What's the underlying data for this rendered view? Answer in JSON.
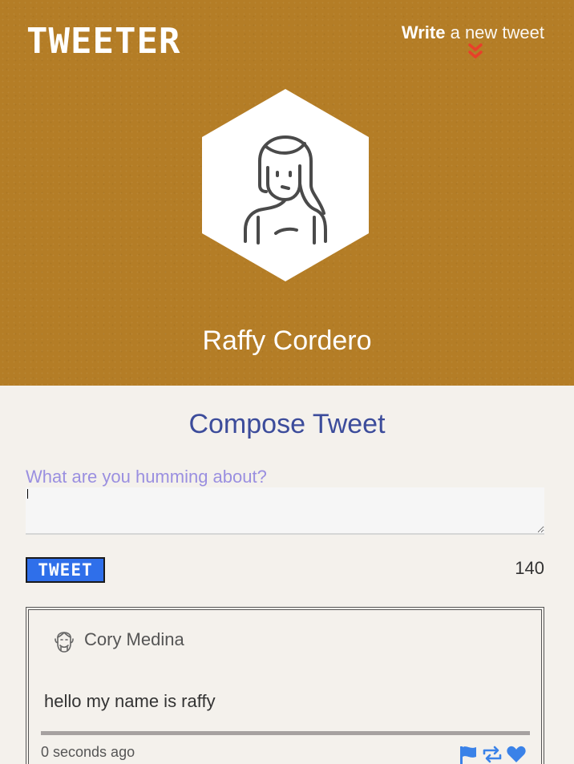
{
  "header": {
    "logo": "TWEETER",
    "write_strong": "Write",
    "write_rest": " a new tweet",
    "user_name": "Raffy Cordero"
  },
  "compose": {
    "title": "Compose Tweet",
    "prompt": "What are you humming about?",
    "input_value": "",
    "button_label": "TWEET",
    "counter": "140"
  },
  "tweets": [
    {
      "author": "Cory Medina",
      "text": "hello my name is raffy",
      "time": "0 seconds ago"
    }
  ],
  "colors": {
    "header_bg": "#b47d26",
    "accent_blue": "#2f6fea",
    "title_blue": "#3c4c9b",
    "chevron_red": "#e8402a"
  },
  "icons": [
    "chevron-down-icon",
    "avatar-icon",
    "flag-icon",
    "retweet-icon",
    "heart-icon"
  ]
}
